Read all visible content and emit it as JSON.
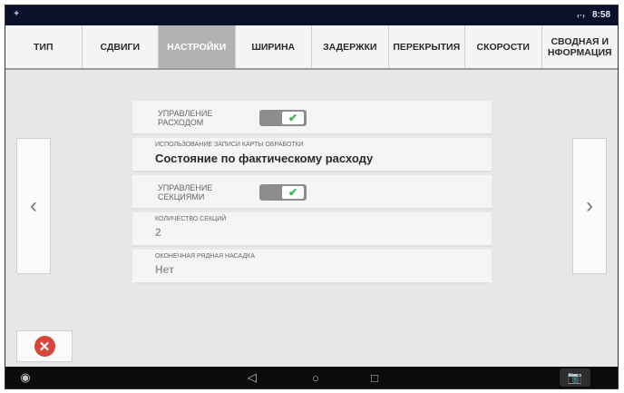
{
  "status_bar": {
    "time": "8:58",
    "signal_icon": "signal-icon"
  },
  "tabs": [
    {
      "label": "ТИП",
      "active": false
    },
    {
      "label": "СДВИГИ",
      "active": false
    },
    {
      "label": "НАСТРОЙКИ",
      "active": true
    },
    {
      "label": "ШИРИНА",
      "active": false
    },
    {
      "label": "ЗАДЕРЖКИ",
      "active": false
    },
    {
      "label": "ПЕРЕКРЫТИЯ",
      "active": false
    },
    {
      "label": "СКОРОСТИ",
      "active": false
    },
    {
      "label": "СВОДНАЯ И НФОРМАЦИЯ",
      "active": false
    }
  ],
  "settings": {
    "rate_control": {
      "label": "УПРАВЛЕНИЕ РАСХОДОМ",
      "enabled": true
    },
    "map_usage": {
      "label": "ИСПОЛЬЗОВАНИЕ ЗАПИСИ КАРТЫ ОБРАБОТКИ",
      "value": "Состояние по фактическому расходу"
    },
    "section_control": {
      "label": "УПРАВЛЕНИЕ СЕКЦИЯМИ",
      "enabled": true
    },
    "section_count": {
      "label": "КОЛИЧЕСТВО СЕКЦИЙ",
      "value": "2"
    },
    "end_nozzle": {
      "label": "ОКОНЕЧНАЯ РЯДНАЯ НАСАДКА",
      "value": "Нет"
    }
  },
  "nav": {
    "left_arrow": "‹",
    "right_arrow": "›"
  },
  "colors": {
    "active_tab": "#b2b2b2",
    "toggle_on": "#39b54a",
    "close_red": "#d6473b"
  }
}
